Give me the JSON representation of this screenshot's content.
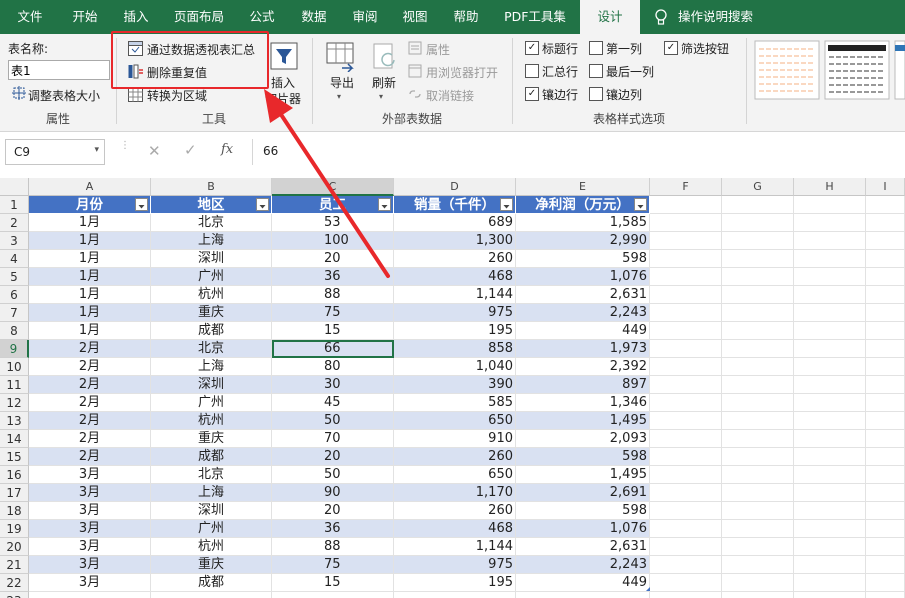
{
  "tabs": [
    "文件",
    "开始",
    "插入",
    "页面布局",
    "公式",
    "数据",
    "审阅",
    "视图",
    "帮助",
    "PDF工具集",
    "设计"
  ],
  "tell_me": "操作说明搜索",
  "ribbon": {
    "properties": {
      "table_name_label": "表名称:",
      "table_name_value": "表1",
      "resize_label": "调整表格大小",
      "group_label": "属性"
    },
    "tools": {
      "pivot_label": "通过数据透视表汇总",
      "remove_dup_label": "删除重复值",
      "convert_label": "转换为区域",
      "slicer_label_1": "插入",
      "slicer_label_2": "切片器",
      "group_label": "工具"
    },
    "external": {
      "export_label": "导出",
      "refresh_label": "刷新",
      "properties_label": "属性",
      "open_browser_label": "用浏览器打开",
      "unlink_label": "取消链接",
      "group_label": "外部表数据"
    },
    "style_options": {
      "header_row": "标题行",
      "total_row": "汇总行",
      "banded_rows": "镶边行",
      "first_column": "第一列",
      "last_column": "最后一列",
      "banded_columns": "镶边列",
      "filter_button": "筛选按钮",
      "group_label": "表格样式选项"
    }
  },
  "formula_bar": {
    "name_box": "C9",
    "formula": "66",
    "fx": "fx"
  },
  "columns": [
    "A",
    "B",
    "C",
    "D",
    "E",
    "F",
    "G",
    "H",
    "I"
  ],
  "table_headers": [
    "月份",
    "地区",
    "员工",
    "销量（千件）",
    "净利润（万元）"
  ],
  "rows": [
    [
      "1月",
      "北京",
      "53",
      "689",
      "1,585"
    ],
    [
      "1月",
      "上海",
      "100",
      "1,300",
      "2,990"
    ],
    [
      "1月",
      "深圳",
      "20",
      "260",
      "598"
    ],
    [
      "1月",
      "广州",
      "36",
      "468",
      "1,076"
    ],
    [
      "1月",
      "杭州",
      "88",
      "1,144",
      "2,631"
    ],
    [
      "1月",
      "重庆",
      "75",
      "975",
      "2,243"
    ],
    [
      "1月",
      "成都",
      "15",
      "195",
      "449"
    ],
    [
      "2月",
      "北京",
      "66",
      "858",
      "1,973"
    ],
    [
      "2月",
      "上海",
      "80",
      "1,040",
      "2,392"
    ],
    [
      "2月",
      "深圳",
      "30",
      "390",
      "897"
    ],
    [
      "2月",
      "广州",
      "45",
      "585",
      "1,346"
    ],
    [
      "2月",
      "杭州",
      "50",
      "650",
      "1,495"
    ],
    [
      "2月",
      "重庆",
      "70",
      "910",
      "2,093"
    ],
    [
      "2月",
      "成都",
      "20",
      "260",
      "598"
    ],
    [
      "3月",
      "北京",
      "50",
      "650",
      "1,495"
    ],
    [
      "3月",
      "上海",
      "90",
      "1,170",
      "2,691"
    ],
    [
      "3月",
      "深圳",
      "20",
      "260",
      "598"
    ],
    [
      "3月",
      "广州",
      "36",
      "468",
      "1,076"
    ],
    [
      "3月",
      "杭州",
      "88",
      "1,144",
      "2,631"
    ],
    [
      "3月",
      "重庆",
      "75",
      "975",
      "2,243"
    ],
    [
      "3月",
      "成都",
      "15",
      "195",
      "449"
    ]
  ],
  "colors": {
    "ribbon_green": "#217346",
    "table_header": "#4472c4",
    "band": "#d9e1f2",
    "highlight": "#e8282b"
  }
}
